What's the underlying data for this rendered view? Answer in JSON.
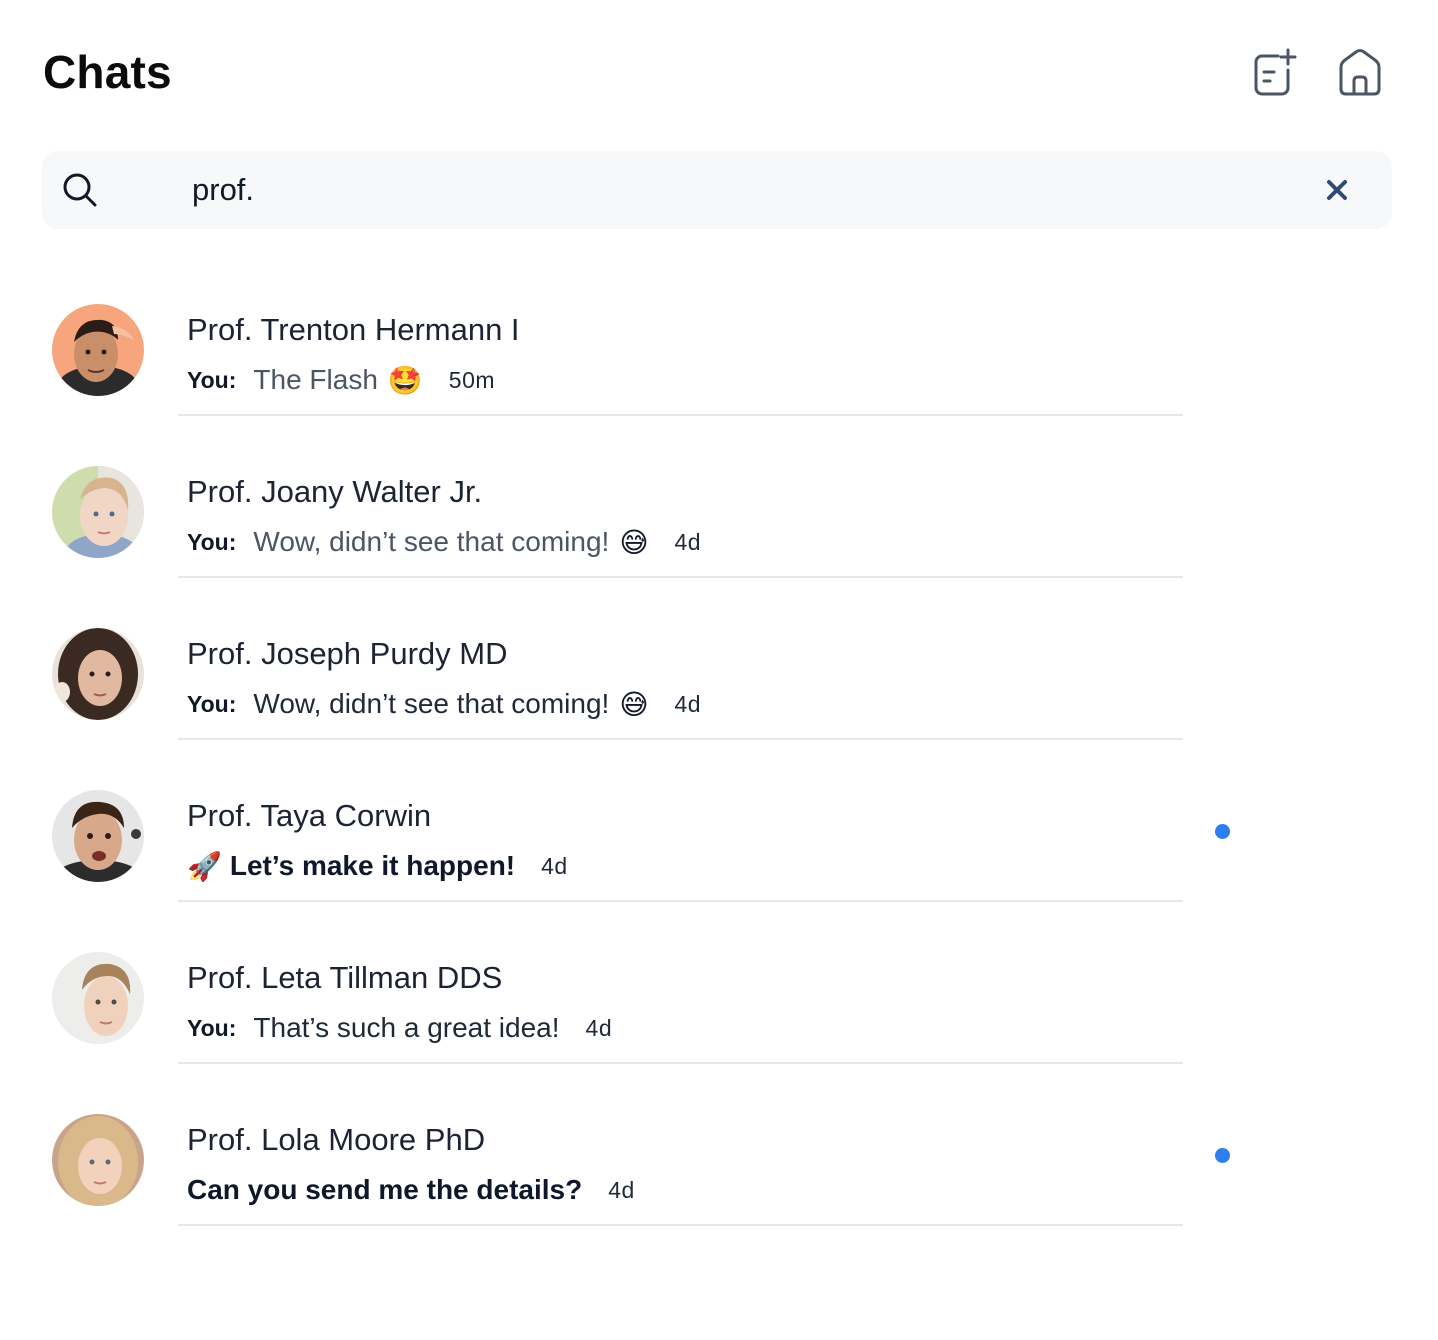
{
  "header": {
    "title": "Chats",
    "new_chat_icon": "new-chat-icon",
    "home_icon": "home-icon"
  },
  "search": {
    "value": "prof.",
    "search_icon": "search-icon",
    "clear_icon": "close-icon"
  },
  "colors": {
    "unread_dot": "#2f7ef0",
    "clear_icon": "#2c4a73",
    "divider": "#e5e7eb",
    "search_bg": "#f7f8fa"
  },
  "chats": [
    {
      "name": "Prof. Trenton Hermann I",
      "you_label": "You:",
      "message": "The Flash",
      "emoji": "🤩",
      "time": "50m",
      "unread": false
    },
    {
      "name": "Prof. Joany Walter Jr.",
      "you_label": "You:",
      "message": "Wow, didn’t see that coming!",
      "emoji": "😅",
      "time": "4d",
      "unread": false
    },
    {
      "name": "Prof. Joseph Purdy MD",
      "you_label": "You:",
      "message": "Wow, didn’t see that coming!",
      "emoji": "😅",
      "time": "4d",
      "unread": false
    },
    {
      "name": "Prof. Taya Corwin",
      "lead_emoji": "🚀",
      "message": "Let’s make it happen!",
      "time": "4d",
      "unread": true
    },
    {
      "name": "Prof. Leta Tillman DDS",
      "you_label": "You:",
      "message": "That’s such a great idea!",
      "time": "4d",
      "unread": false
    },
    {
      "name": "Prof. Lola Moore PhD",
      "message": "Can you send me the details?",
      "time": "4d",
      "unread": true
    }
  ]
}
